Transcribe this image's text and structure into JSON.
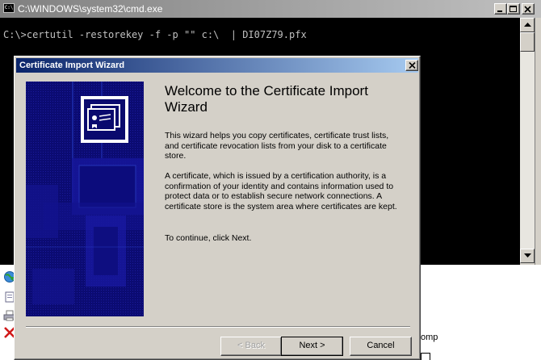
{
  "cmd": {
    "title": "C:\\WINDOWS\\system32\\cmd.exe",
    "icon_text": "C:\\",
    "command_line": "C:\\>certutil -restorekey -f -p \"\" c:\\  | DI07Z79.pfx"
  },
  "background": {
    "partial_text": "omp"
  },
  "wizard": {
    "title": "Certificate Import Wizard",
    "heading": "Welcome to the Certificate Import Wizard",
    "paragraph1": "This wizard helps you copy certificates, certificate trust lists, and certificate revocation lists from your disk to a certificate store.",
    "paragraph2": "A certificate, which is issued by a certification authority, is a confirmation of your identity and contains information used to protect data or to establish secure network connections. A certificate store is the system area where certificates are kept.",
    "paragraph3": "To continue, click Next.",
    "buttons": {
      "back": "< Back",
      "next": "Next >",
      "cancel": "Cancel"
    }
  },
  "colors": {
    "dialog_face": "#d4d0c8",
    "active_title": "#0a246a",
    "inactive_title": "#808080",
    "banner": "#0a0a6e",
    "console": "#000000"
  }
}
